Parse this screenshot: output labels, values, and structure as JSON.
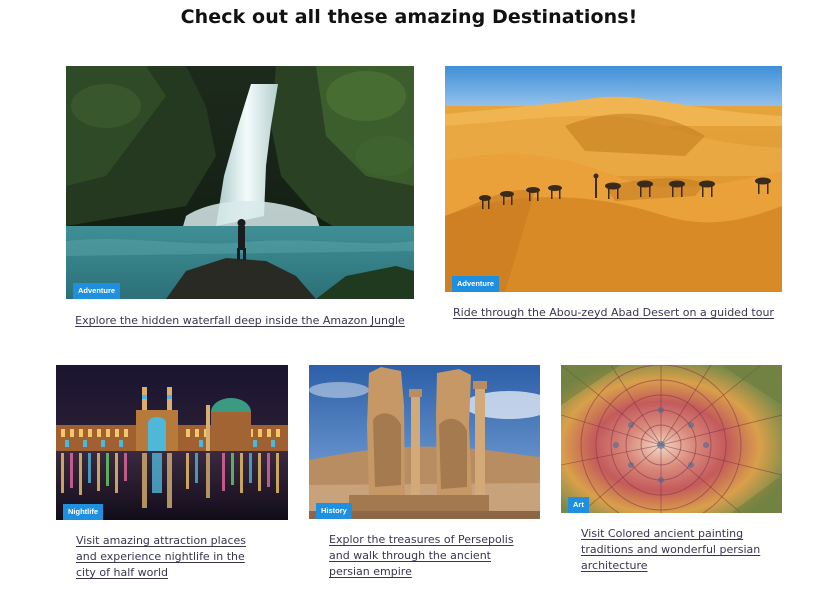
{
  "page": {
    "title": "Check out all these amazing Destinations!"
  },
  "colors": {
    "badge_bg": "#1f8fe0",
    "link_text": "#3a3550"
  },
  "cards": [
    {
      "image": "waterfall-photo",
      "badge": "Adventure",
      "link": "Explore the hidden waterfall deep inside the Amazon Jungle"
    },
    {
      "image": "desert-camel-caravan-photo",
      "badge": "Adventure",
      "link": "Ride through the Abou-zeyd Abad Desert on a guided tour"
    },
    {
      "image": "mosque-night-reflection-photo",
      "badge": "Nightlife",
      "link": "Visit amazing attraction places and experience nightlife in the city of half world"
    },
    {
      "image": "persepolis-ruins-photo",
      "badge": "History",
      "link": "Explor the treasures of Persepolis and walk through the ancient persian empire"
    },
    {
      "image": "persian-tile-dome-photo",
      "badge": "Art",
      "link": "Visit Colored ancient painting traditions and wonderful persian architecture"
    }
  ]
}
